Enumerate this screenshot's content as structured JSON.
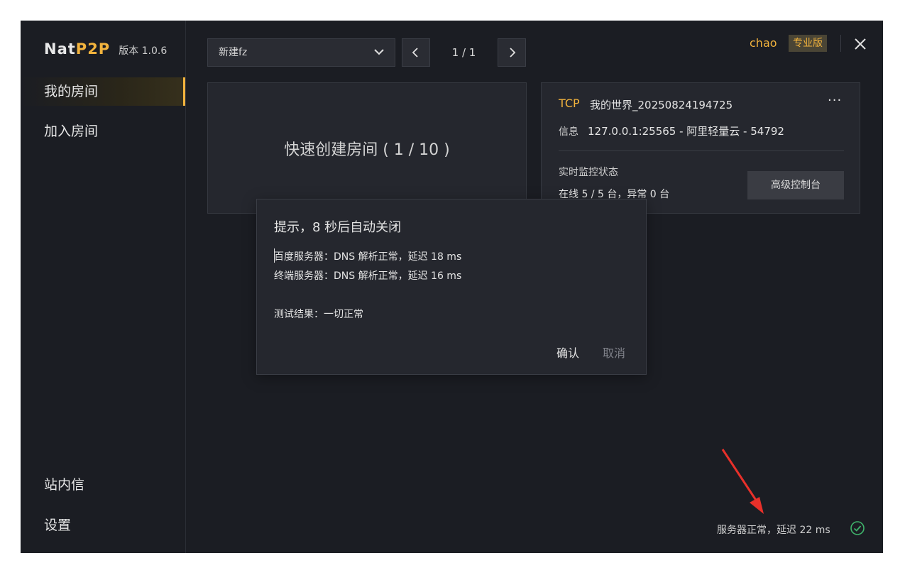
{
  "app": {
    "logo_nat": "Nat",
    "logo_p2p": "P2P",
    "version": "版本 1.0.6"
  },
  "sidebar": {
    "items": [
      {
        "label": "我的房间",
        "active": true
      },
      {
        "label": "加入房间",
        "active": false
      }
    ],
    "bottom_items": [
      {
        "label": "站内信"
      },
      {
        "label": "设置"
      }
    ]
  },
  "toolbar": {
    "selected_group": "新建fz",
    "page_indicator": "1 / 1",
    "username": "chao",
    "plan_badge": "专业版"
  },
  "quick_create": {
    "label": "快速创建房间 ( 1 / 10 )"
  },
  "room_card": {
    "protocol": "TCP",
    "name": "我的世界_20250824194725",
    "more": "···",
    "info_label": "信息",
    "info_value": "127.0.0.1:25565 - 阿里轻量云 - 54792",
    "monitor_label": "实时监控状态",
    "monitor_value": "在线 5 / 5 台，异常 0 台",
    "advanced_button": "高级控制台"
  },
  "dialog": {
    "title": "提示，8 秒后自动关闭",
    "lines": [
      "百度服务器：DNS 解析正常，延迟 18 ms",
      "终端服务器：DNS 解析正常，延迟 16 ms",
      "测试结果：一切正常"
    ],
    "confirm": "确认",
    "cancel": "取消"
  },
  "status_bar": {
    "text": "服务器正常，延迟 22 ms"
  },
  "colors": {
    "accent": "#f2b33d",
    "background": "#1b1d23",
    "card": "#25272e",
    "ok_green": "#3fb36b",
    "annotation_red": "#e8302a"
  },
  "icons": {
    "select_toggle": "chevron-down-icon",
    "prev": "chevron-left-icon",
    "next": "chevron-right-icon",
    "close": "close-icon",
    "status": "check-circle-icon"
  }
}
